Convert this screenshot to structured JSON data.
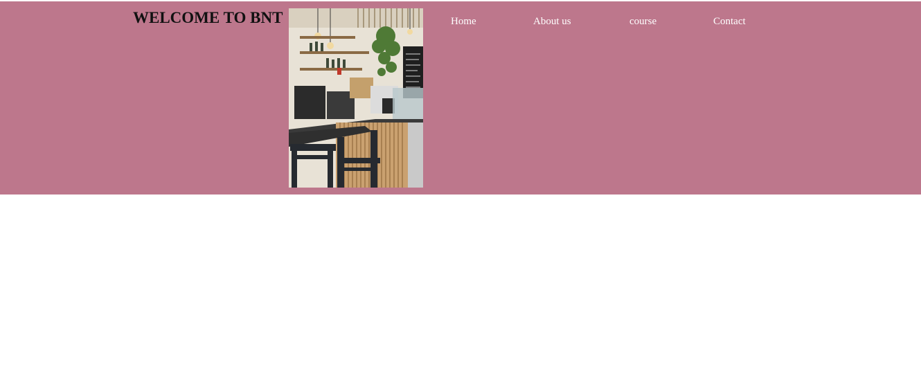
{
  "header": {
    "title": "WELCOME TO BNT",
    "background_color": "#bd778c",
    "image": {
      "description_icon": "cafe-interior-photo"
    }
  },
  "nav": {
    "items": [
      {
        "label": "Home"
      },
      {
        "label": "About us"
      },
      {
        "label": "course"
      },
      {
        "label": "Contact"
      }
    ],
    "link_color": "#ffffff"
  }
}
